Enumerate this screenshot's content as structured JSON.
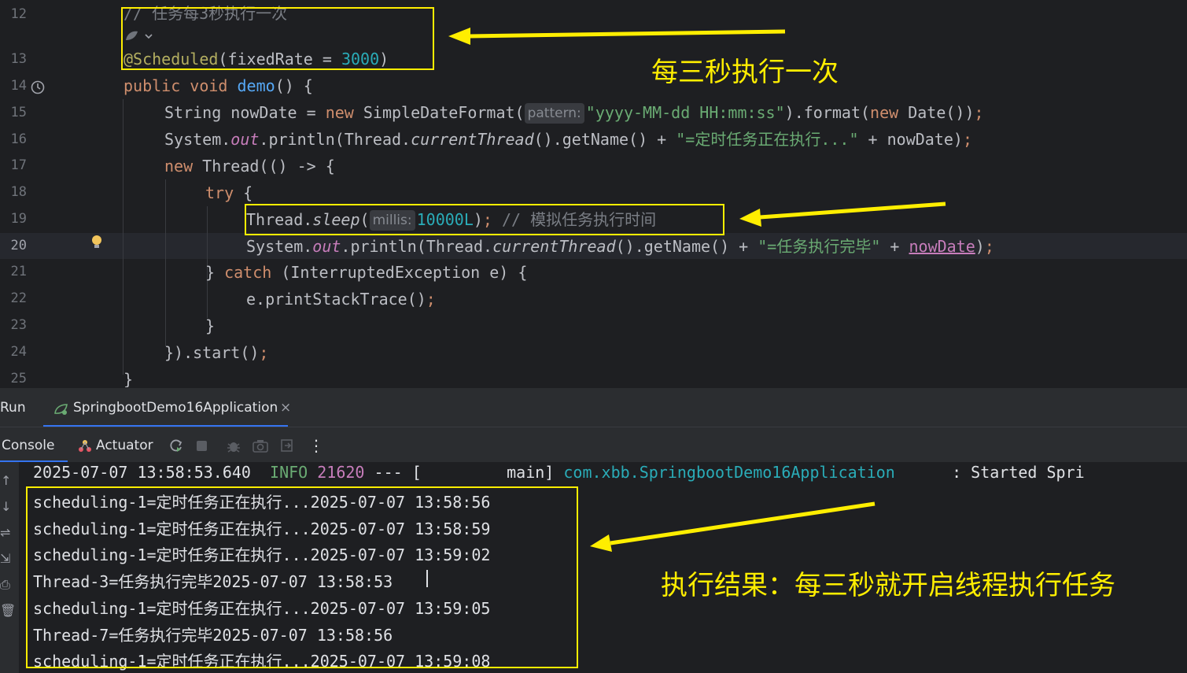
{
  "editor": {
    "line_numbers": [
      "12",
      "13",
      "14",
      "15",
      "16",
      "17",
      "18",
      "19",
      "20",
      "21",
      "22",
      "23",
      "24",
      "25"
    ],
    "line12": "// 任务每3秒执行一次",
    "line13": {
      "at": "@Scheduled",
      "open": "(fixedRate = ",
      "num": "3000",
      "close": ")"
    },
    "line14": {
      "k1": "public",
      "k2": "void",
      "name": "demo",
      "rest": "() {"
    },
    "line15": {
      "a": "String nowDate = ",
      "k": "new",
      "b": " SimpleDateFormat(",
      "hint": "pattern:",
      "s": "\"yyyy-MM-dd HH:mm:ss\"",
      "c": ").format(",
      "k2": "new",
      "d": " Date())",
      "e": ";"
    },
    "line16": {
      "a": "System.",
      "out": "out",
      "b": ".println(Thread.",
      "ct": "currentThread",
      "c": "().getName() + ",
      "s": "\"=定时任务正在执行...\"",
      "d": " + nowDate)",
      "e": ";"
    },
    "line17": {
      "k": "new",
      "rest": " Thread(() -> {"
    },
    "line18": {
      "k": "try",
      "rest": " {"
    },
    "line19": {
      "a": "Thread.",
      "sl": "sleep",
      "b": "(",
      "hint": "millis:",
      "n": "10000L",
      "c": ")",
      "e": "; ",
      "com": "// 模拟任务执行时间"
    },
    "line20": {
      "a": "System.",
      "out": "out",
      "b": ".println(Thread.",
      "ct": "currentThread",
      "c": "().getName() + ",
      "s": "\"=任务执行完毕\"",
      "d": " + ",
      "u": "nowDate",
      "f": ")",
      "e": ";"
    },
    "line21": {
      "a": "} ",
      "k": "catch",
      "rest": " (InterruptedException e) {"
    },
    "line22": {
      "a": "e.printStackTrace()",
      "e": ";"
    },
    "line23": "}",
    "line24": {
      "a": "}).start()",
      "e": ";"
    },
    "line25": "}"
  },
  "annotations": {
    "top": "每三秒执行一次",
    "bottom": "执行结果：每三秒就开启线程执行任务"
  },
  "run_panel": {
    "title": "Run",
    "tab_label": "SpringbootDemo16Application",
    "close_glyph": "×"
  },
  "toolbar": {
    "console_tab": "Console",
    "actuator_tab": "Actuator"
  },
  "console": {
    "header": {
      "timestamp": "2025-07-07 13:58:53.640",
      "level": "INFO",
      "pid": "21620",
      "sep": "--- [",
      "thread": "main]",
      "logger": "com.xbb.SpringbootDemo16Application",
      "msg": ": Started Spri"
    },
    "lines": [
      "scheduling-1=定时任务正在执行...2025-07-07 13:58:56",
      "scheduling-1=定时任务正在执行...2025-07-07 13:58:59",
      "scheduling-1=定时任务正在执行...2025-07-07 13:59:02",
      "Thread-3=任务执行完毕2025-07-07 13:58:53",
      "scheduling-1=定时任务正在执行...2025-07-07 13:59:05",
      "Thread-7=任务执行完毕2025-07-07 13:58:56",
      "scheduling-1=定时任务正在执行...2025-07-07 13:59:08"
    ]
  },
  "colors": {
    "annotation": "#ffee00",
    "keyword": "#cf8e6d",
    "string": "#6aab73",
    "number": "#2aacb8"
  }
}
